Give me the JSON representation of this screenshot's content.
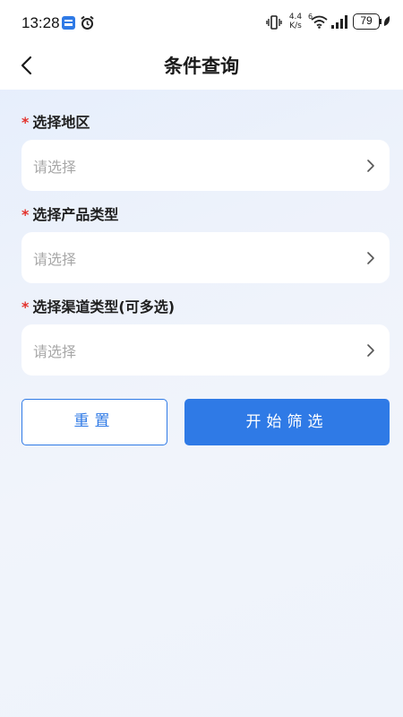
{
  "status_bar": {
    "time": "13:28",
    "network_speed": "4.4",
    "network_unit": "K/s",
    "wifi_badge": "6",
    "battery": "79"
  },
  "nav": {
    "title": "条件查询",
    "back_icon": "chevron-left-icon"
  },
  "form": {
    "fields": [
      {
        "required_mark": "*",
        "label": "选择地区",
        "placeholder": "请选择"
      },
      {
        "required_mark": "*",
        "label": "选择产品类型",
        "placeholder": "请选择"
      },
      {
        "required_mark": "*",
        "label": "选择渠道类型(可多选)",
        "placeholder": "请选择"
      }
    ]
  },
  "actions": {
    "reset_label": "重置",
    "start_label": "开始筛选"
  },
  "colors": {
    "accent": "#2f7ae6",
    "required": "#e3312b"
  }
}
